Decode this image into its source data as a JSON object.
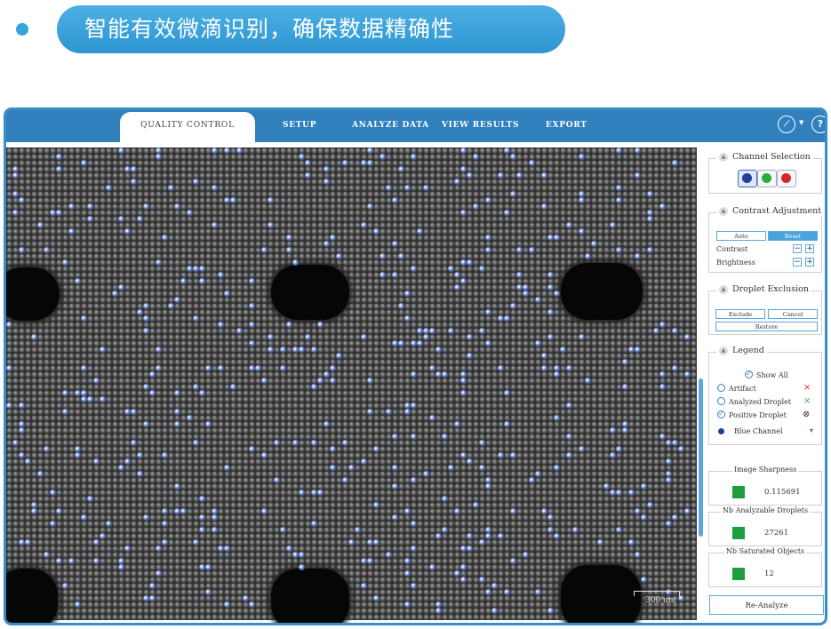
{
  "banner": {
    "text": "智能有效微滴识别，确保数据精确性"
  },
  "nav": {
    "tabs": [
      "QUALITY CONTROL",
      "SETUP",
      "ANALYZE DATA",
      "VIEW RESULTS",
      "EXPORT"
    ],
    "active_tab": "QUALITY CONTROL",
    "help_label": "?"
  },
  "image": {
    "scale_label": "300 um"
  },
  "panel": {
    "channel_selection": {
      "title": "Channel Selection",
      "channels": [
        {
          "name": "blue",
          "color": "#1f3f99",
          "selected": true
        },
        {
          "name": "green",
          "color": "#2eab3f",
          "selected": false
        },
        {
          "name": "red",
          "color": "#d7242a",
          "selected": false
        }
      ]
    },
    "contrast": {
      "title": "Contrast Adjustment",
      "auto_label": "Auto",
      "reset_label": "Reset",
      "contrast_label": "Contrast",
      "brightness_label": "Brightness",
      "minus": "−",
      "plus": "+"
    },
    "exclusion": {
      "title": "Droplet Exclusion",
      "exclude_label": "Exclude",
      "cancel_label": "Cancel",
      "restore_label": "Restore"
    },
    "legend": {
      "title": "Legend",
      "show_all": "Show All",
      "artifact": "Artifact",
      "analyzed": "Analyzed Droplet",
      "positive": "Positive Droplet",
      "channel": "Blue Channel",
      "artifact_mark": "×",
      "analyzed_mark": "×",
      "positive_mark": "⊗",
      "check": "✓",
      "dropdown_arrow": "▾"
    },
    "stats": [
      {
        "title": "Image Sharpness",
        "value": "0.115691"
      },
      {
        "title": "Nb Analyzable Droplets",
        "value": "27261"
      },
      {
        "title": "Nb Saturated Objects",
        "value": "12"
      }
    ],
    "reanalyze_label": "Re-Analyze"
  },
  "colors": {
    "accent": "#2f80bd",
    "banner": "#35a3dc",
    "stat_square": "#1f9e3f"
  }
}
